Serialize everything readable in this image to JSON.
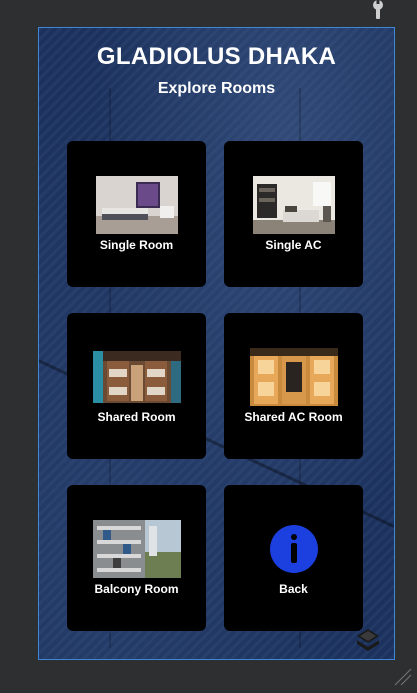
{
  "header": {
    "title": "GLADIOLUS DHAKA",
    "subtitle": "Explore Rooms"
  },
  "rooms": [
    {
      "label": "Single Room",
      "image": "single-room-photo"
    },
    {
      "label": "Single AC",
      "image": "single-ac-photo"
    },
    {
      "label": "Shared Room",
      "image": "shared-room-photo"
    },
    {
      "label": "Shared AC Room",
      "image": "shared-ac-room-photo"
    },
    {
      "label": "Balcony Room",
      "image": "balcony-room-photo"
    }
  ],
  "back": {
    "label": "Back",
    "icon": "info-icon"
  },
  "colors": {
    "background": "#2e2f31",
    "panel": "#1d3461",
    "panel_border": "#3f86d6",
    "card": "#000000",
    "info_accent": "#1c3fe0"
  }
}
